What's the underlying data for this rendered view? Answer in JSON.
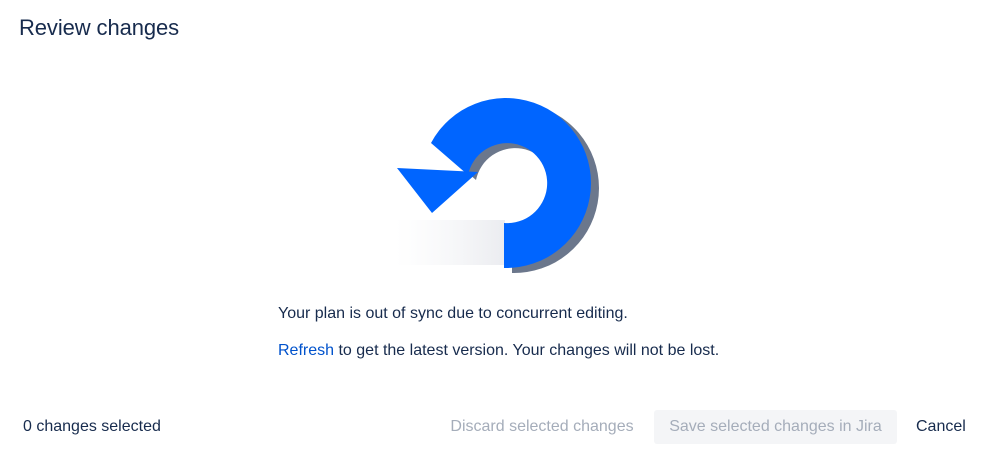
{
  "dialog": {
    "title": "Review changes"
  },
  "illustration": {
    "icon": "refresh-arrow-icon",
    "colors": {
      "arrow": "#0065ff",
      "shadow": "#6b778c"
    }
  },
  "body": {
    "message": "Your plan is out of sync due to concurrent editing.",
    "refresh_link": "Refresh",
    "refresh_suffix": " to get the latest version. Your changes will not be lost."
  },
  "footer": {
    "selected_count_text": "0 changes selected",
    "discard_label": "Discard selected changes",
    "save_label": "Save selected changes in Jira",
    "cancel_label": "Cancel"
  }
}
